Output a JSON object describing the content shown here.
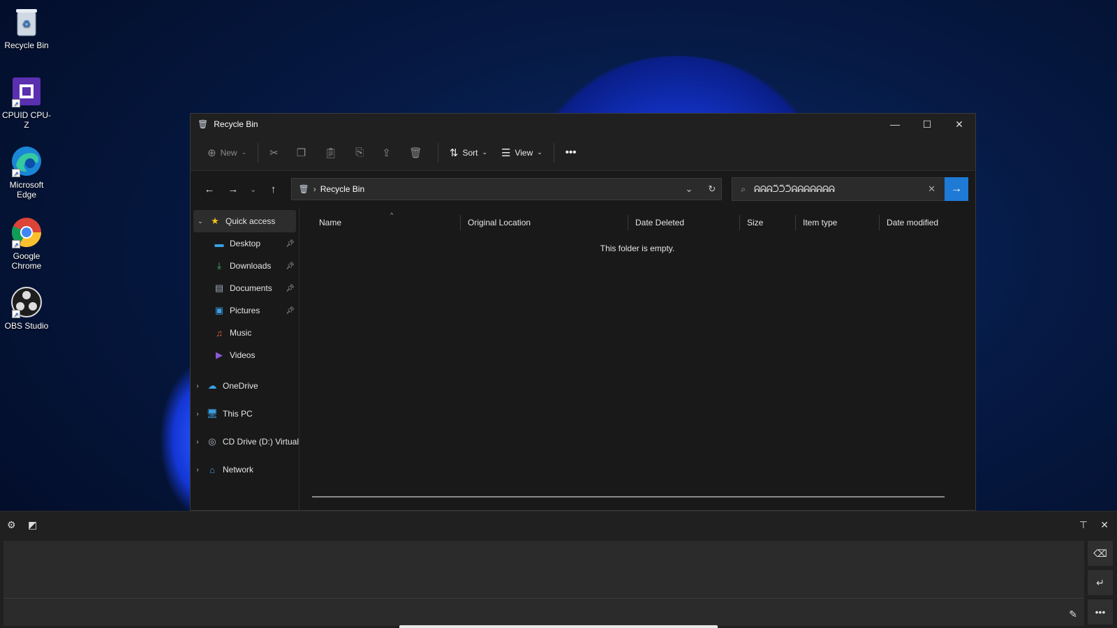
{
  "desktop": {
    "icons": [
      {
        "label": "Recycle Bin",
        "icon": "recycle-bin-icon"
      },
      {
        "label": "CPUID CPU-Z",
        "icon": "cpu-z-icon"
      },
      {
        "label": "Microsoft Edge",
        "icon": "edge-icon"
      },
      {
        "label": "Google Chrome",
        "icon": "chrome-icon"
      },
      {
        "label": "OBS Studio",
        "icon": "obs-icon"
      }
    ]
  },
  "window": {
    "title": "Recycle Bin",
    "commands": {
      "new": "New",
      "sort": "Sort",
      "view": "View"
    },
    "address": {
      "crumb": "Recycle Bin"
    },
    "search": {
      "query": "ᕱᕱᕱᑒᑒᑒᕱᕱᕱᕱᕱᕱᕱ"
    },
    "sidebar": {
      "quick_access": "Quick access",
      "items": [
        {
          "label": "Desktop",
          "icon": "desktop-folder-icon",
          "pinned": true
        },
        {
          "label": "Downloads",
          "icon": "downloads-icon",
          "pinned": true
        },
        {
          "label": "Documents",
          "icon": "documents-icon",
          "pinned": true
        },
        {
          "label": "Pictures",
          "icon": "pictures-icon",
          "pinned": true
        },
        {
          "label": "Music",
          "icon": "music-icon",
          "pinned": false
        },
        {
          "label": "Videos",
          "icon": "videos-icon",
          "pinned": false
        }
      ],
      "roots": [
        {
          "label": "OneDrive",
          "icon": "onedrive-icon"
        },
        {
          "label": "This PC",
          "icon": "this-pc-icon"
        },
        {
          "label": "CD Drive (D:) Virtual",
          "icon": "cd-drive-icon"
        },
        {
          "label": "Network",
          "icon": "network-icon"
        }
      ]
    },
    "columns": [
      "Name",
      "Original Location",
      "Date Deleted",
      "Size",
      "Item type",
      "Date modified"
    ],
    "empty_message": "This folder is empty."
  },
  "colors": {
    "accent": "#1f7ad6",
    "window_bg": "#191919",
    "chrome_bg": "#202020"
  }
}
